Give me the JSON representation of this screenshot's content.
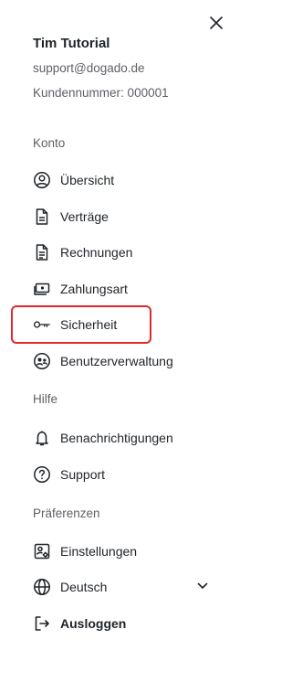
{
  "user": {
    "name": "Tim Tutorial",
    "email": "support@dogado.de",
    "customer_number": "Kundennummer: 000001"
  },
  "sections": {
    "account": "Konto",
    "help": "Hilfe",
    "preferences": "Präferenzen"
  },
  "nav": {
    "overview": {
      "label": "Übersicht",
      "icon": "user-circle-icon"
    },
    "contracts": {
      "label": "Verträge",
      "icon": "document-icon"
    },
    "invoices": {
      "label": "Rechnungen",
      "icon": "document-lines-icon"
    },
    "payment": {
      "label": "Zahlungsart",
      "icon": "banknote-icon"
    },
    "security": {
      "label": "Sicherheit",
      "icon": "key-icon"
    },
    "user_management": {
      "label": "Benutzerverwaltung",
      "icon": "users-circle-icon"
    },
    "notifications": {
      "label": "Benachrichtigungen",
      "icon": "bell-icon"
    },
    "support": {
      "label": "Support",
      "icon": "question-circle-icon"
    },
    "settings": {
      "label": "Einstellungen",
      "icon": "user-settings-icon"
    },
    "language": {
      "label": "Deutsch",
      "icon": "globe-icon"
    },
    "logout": {
      "label": "Ausloggen",
      "icon": "logout-icon"
    }
  },
  "colors": {
    "highlight": "#e02b2b",
    "text": "#1f2328",
    "muted": "#5d6066"
  }
}
